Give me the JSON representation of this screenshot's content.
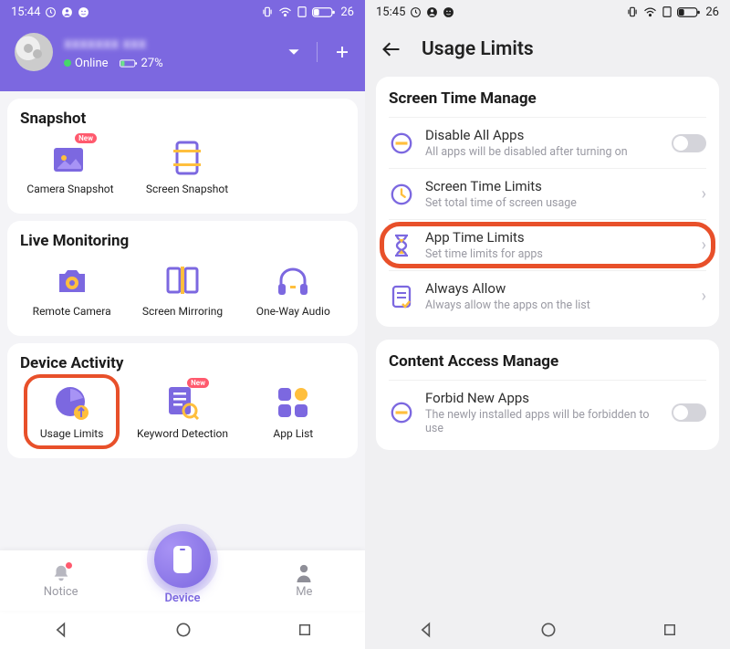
{
  "left": {
    "status": {
      "time": "15:44",
      "battery": "26"
    },
    "header": {
      "username": "xxxxxxx xxx",
      "online_label": "Online",
      "battery_pct": "27%"
    },
    "sections": {
      "snapshot": {
        "title": "Snapshot",
        "items": [
          {
            "label": "Camera Snapshot"
          },
          {
            "label": "Screen Snapshot"
          }
        ]
      },
      "live": {
        "title": "Live Monitoring",
        "items": [
          {
            "label": "Remote Camera"
          },
          {
            "label": "Screen Mirroring"
          },
          {
            "label": "One-Way Audio"
          }
        ]
      },
      "activity": {
        "title": "Device Activity",
        "items": [
          {
            "label": "Usage Limits"
          },
          {
            "label": "Keyword Detection"
          },
          {
            "label": "App List"
          }
        ]
      }
    },
    "nav": {
      "notice": "Notice",
      "device": "Device",
      "me": "Me"
    }
  },
  "right": {
    "status": {
      "time": "15:45",
      "battery": "26"
    },
    "title": "Usage Limits",
    "screen_time": {
      "title": "Screen Time Manage",
      "disable_all": {
        "title": "Disable All Apps",
        "sub": "All apps will be disabled after turning on"
      },
      "screen_limits": {
        "title": "Screen Time Limits",
        "sub": "Set total time of screen usage"
      },
      "app_limits": {
        "title": "App Time Limits",
        "sub": "Set time limits for apps"
      },
      "always_allow": {
        "title": "Always Allow",
        "sub": "Always allow the apps on the list"
      }
    },
    "content_access": {
      "title": "Content Access Manage",
      "forbid": {
        "title": "Forbid New Apps",
        "sub": "The newly installed apps will be forbidden to use"
      }
    }
  },
  "badges": {
    "new": "New"
  }
}
